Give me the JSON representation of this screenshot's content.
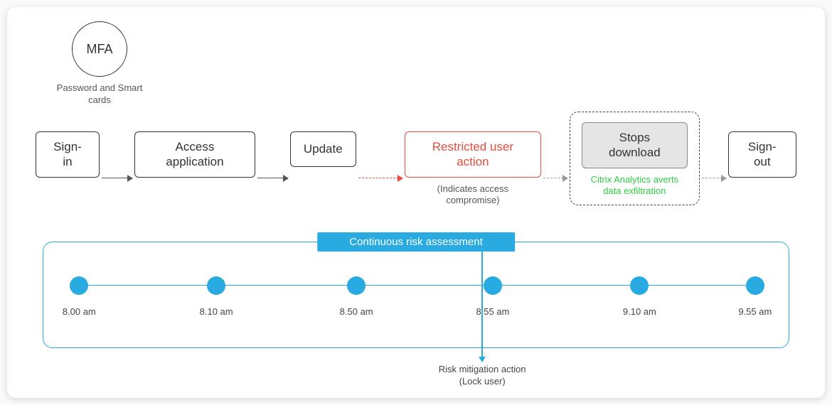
{
  "mfa": {
    "title": "MFA",
    "subtitle": "Password and Smart cards"
  },
  "flow": {
    "signin": "Sign-in",
    "access": "Access application",
    "update": "Update",
    "restricted": "Restricted user action",
    "restricted_sub": "(Indicates access compromise)",
    "stops": "Stops download",
    "stops_sub": "Citrix Analytics averts data exfiltration",
    "signout": "Sign-out"
  },
  "timeline": {
    "title": "Continuous risk assessment",
    "points": [
      {
        "time": "8.00 am",
        "pos": 4.8
      },
      {
        "time": "8.10 am",
        "pos": 23.2
      },
      {
        "time": "8.50 am",
        "pos": 42.0
      },
      {
        "time": "8.55 am",
        "pos": 60.3
      },
      {
        "time": "9.10 am",
        "pos": 80.0
      },
      {
        "time": "9.55 am",
        "pos": 95.5
      }
    ]
  },
  "risk": {
    "label_line1": "Risk mitigation action",
    "label_line2": "(Lock user)",
    "pos_pct": 58.1
  },
  "colors": {
    "accent": "#29abe2",
    "danger": "#e74c3c",
    "success": "#2ecc40"
  }
}
